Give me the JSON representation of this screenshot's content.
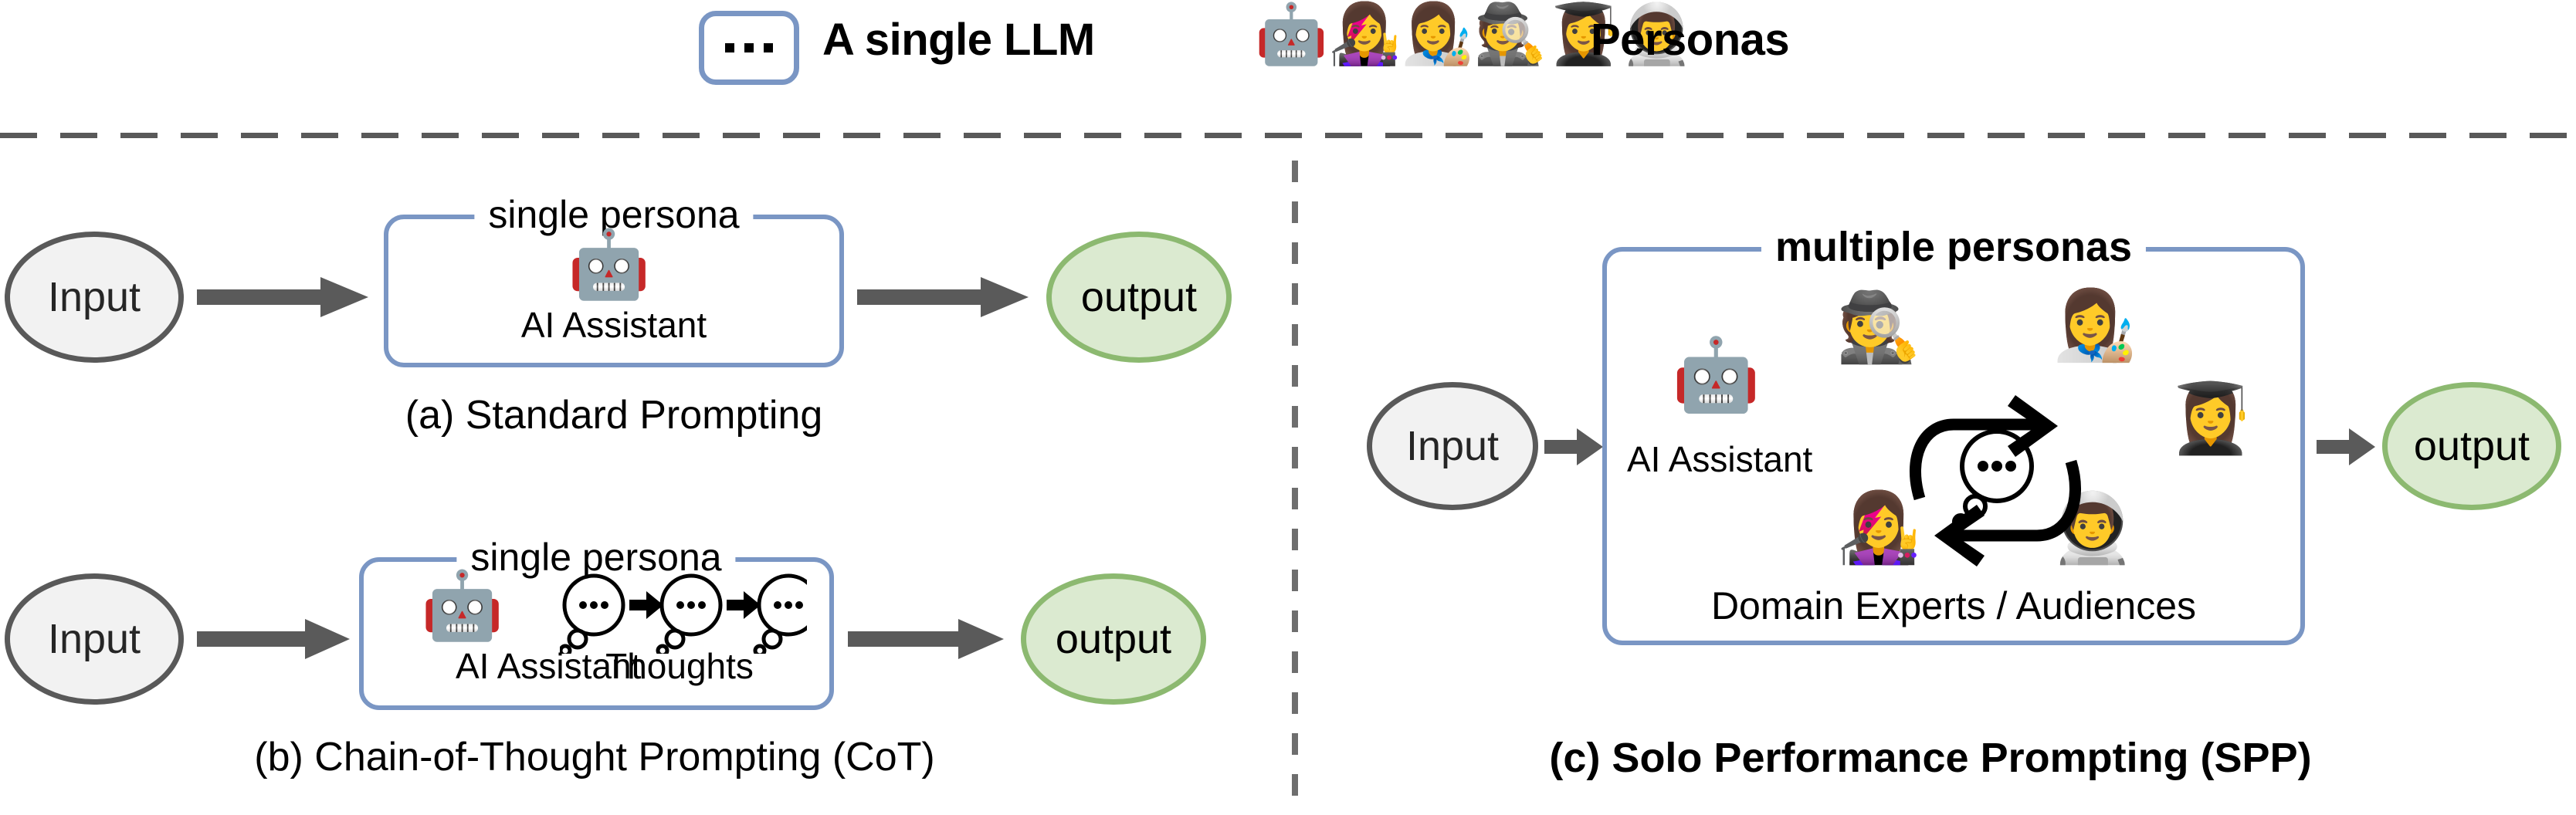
{
  "legend": {
    "llm_box": {
      "icon": "ellipsis-dots-icon",
      "label": "A single LLM"
    },
    "personas": {
      "label": "Personas",
      "icons": [
        {
          "name": "robot-icon",
          "glyph": "🤖"
        },
        {
          "name": "singer-icon",
          "glyph": "👩‍🎤"
        },
        {
          "name": "artist-icon",
          "glyph": "👩‍🎨"
        },
        {
          "name": "detective-icon",
          "glyph": "🕵️"
        },
        {
          "name": "graduate-icon",
          "glyph": "👩‍🎓"
        },
        {
          "name": "astronaut-icon",
          "glyph": "👨‍🚀"
        }
      ]
    }
  },
  "panel_a": {
    "input_label": "Input",
    "box_title": "single persona",
    "agent_icon": "robot-icon",
    "agent_glyph": "🤖",
    "agent_label": "AI Assistant",
    "output_label": "output",
    "caption": "(a) Standard Prompting"
  },
  "panel_b": {
    "input_label": "Input",
    "box_title": "single persona",
    "agent_icon": "robot-icon",
    "agent_glyph": "🤖",
    "agent_label": "AI Assistant",
    "thoughts_label": "Thoughts",
    "thought_bubbles": [
      "···",
      "···",
      "···"
    ],
    "output_label": "output",
    "caption": "(b) Chain-of-Thought Prompting (CoT)"
  },
  "panel_c": {
    "input_label": "Input",
    "box_title": "multiple personas",
    "agent_icon": "robot-icon",
    "agent_glyph": "🤖",
    "agent_label": "AI Assistant",
    "personas_label": "Domain Experts / Audiences",
    "persona_icons": [
      {
        "name": "detective-icon",
        "glyph": "🕵️"
      },
      {
        "name": "artist-icon",
        "glyph": "👩‍🎨"
      },
      {
        "name": "graduate-icon",
        "glyph": "👩‍🎓"
      },
      {
        "name": "singer-icon",
        "glyph": "👩‍🎤"
      },
      {
        "name": "astronaut-icon",
        "glyph": "👨‍🚀"
      }
    ],
    "loop_icon": "cycle-arrows-icon",
    "loop_bubble": "···",
    "output_label": "output",
    "caption": "(c) Solo Performance Prompting (SPP)"
  },
  "colors": {
    "box_border_blue": "#7a96c4",
    "input_fill": "#f2f2f2",
    "input_border": "#595959",
    "output_fill": "#dbead0",
    "output_border": "#8cb970",
    "divider_gray": "#595959",
    "arrow_gray": "#5a5a5a"
  }
}
